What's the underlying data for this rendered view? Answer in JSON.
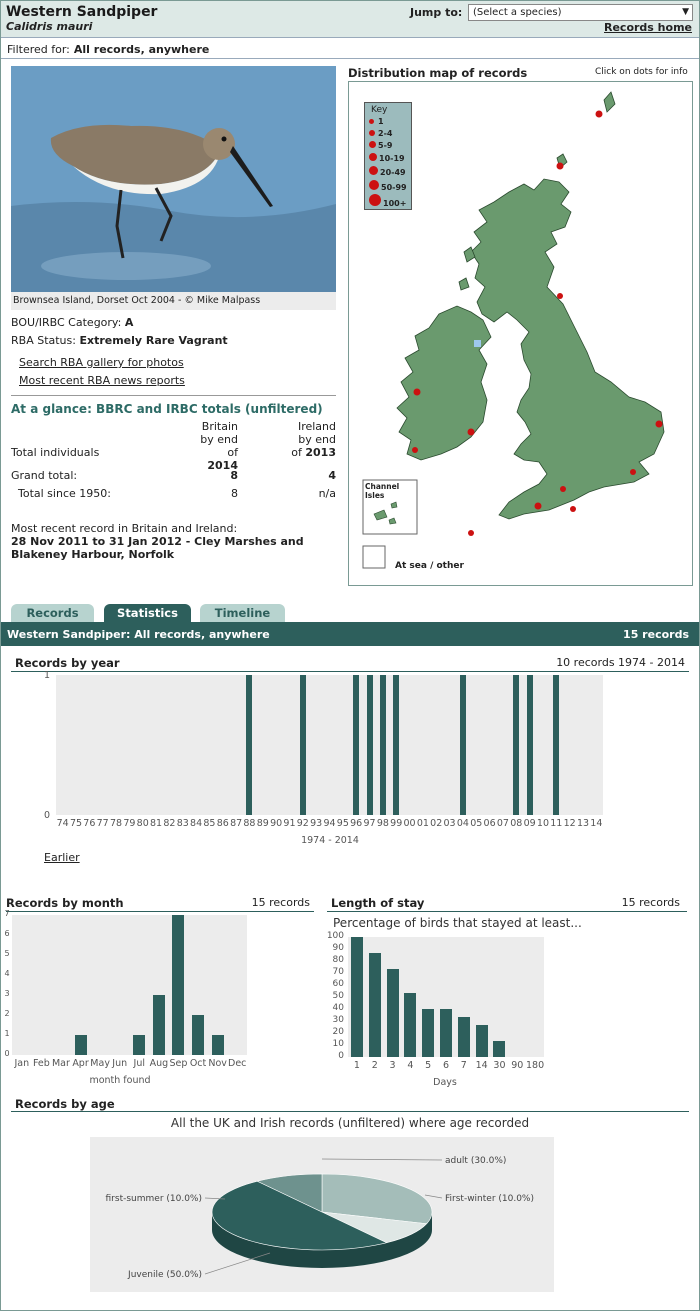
{
  "header": {
    "species": "Western Sandpiper",
    "latin": "Calidris mauri",
    "jump_label": "Jump to:",
    "jump_select": "(Select a species)",
    "records_home": "Records home"
  },
  "filter": {
    "label": "Filtered for:",
    "value": "All records, anywhere"
  },
  "photo": {
    "caption": "Brownsea Island, Dorset Oct 2004 - © Mike Malpass"
  },
  "info": {
    "category_label": "BOU/IRBC Category:",
    "category": "A",
    "status_label": "RBA Status:",
    "status": "Extremely Rare Vagrant",
    "link1": "Search RBA gallery for photos",
    "link2": "Most recent RBA news reports"
  },
  "glance": {
    "title": "At a glance: BBRC and IRBC totals (unfiltered)",
    "britain_head1": "Britain",
    "britain_head2": "by end",
    "britain_head3": "of",
    "britain_year": "2014",
    "ireland_head1": "Ireland",
    "ireland_head2": "by end",
    "ireland_head3": "of",
    "ireland_year": "2013",
    "total_individuals": "Total individuals",
    "grand_total_label": "Grand total:",
    "grand_britain": "8",
    "grand_ireland": "4",
    "since_label": "Total since 1950:",
    "since_britain": "8",
    "since_ireland": "n/a",
    "recent_label": "Most recent record in Britain and Ireland:",
    "recent_line1": "28 Nov 2011 to 31 Jan 2012 - Cley Marshes and",
    "recent_line2": "Blakeney Harbour, Norfolk"
  },
  "map": {
    "title": "Distribution map of records",
    "click": "Click on dots for info",
    "key_title": "Key",
    "key_items": [
      "1",
      "2-4",
      "5-9",
      "10-19",
      "20-49",
      "50-99",
      "100+"
    ],
    "channel": "Channel\nIsles",
    "channel1": "Channel",
    "channel2": "Isles",
    "sea": "At sea / other",
    "land_color": "#6a9a6e",
    "dot_color": "#cc1111"
  },
  "tabs": {
    "records": "Records",
    "statistics": "Statistics",
    "timeline": "Timeline"
  },
  "bar": {
    "species": "Western Sandpiper:",
    "filter": "All records, anywhere",
    "count": "15 records"
  },
  "by_year": {
    "title": "Records by year",
    "summary": "10 records 1974 - 2014",
    "axis_label": "1974 - 2014",
    "earlier": "Earlier",
    "y_top": "1",
    "y_bottom": "0"
  },
  "by_month": {
    "title": "Records by month",
    "summary": "15 records",
    "xlabel": "month found"
  },
  "stay": {
    "title": "Length of stay",
    "summary": "15 records",
    "subtitle": "Percentage of birds that stayed at least...",
    "xlabel": "Days"
  },
  "age": {
    "title": "Records by age",
    "subtitle": "All the UK and Irish records (unfiltered) where age recorded"
  },
  "chart_data": [
    {
      "type": "bar",
      "title": "Records by year",
      "xlabel": "1974 - 2014",
      "categories": [
        "74",
        "75",
        "76",
        "77",
        "78",
        "79",
        "80",
        "81",
        "82",
        "83",
        "84",
        "85",
        "86",
        "87",
        "88",
        "89",
        "90",
        "91",
        "92",
        "93",
        "94",
        "95",
        "96",
        "97",
        "98",
        "99",
        "00",
        "01",
        "02",
        "03",
        "04",
        "05",
        "06",
        "07",
        "08",
        "09",
        "10",
        "11",
        "12",
        "13",
        "14"
      ],
      "values": [
        0,
        0,
        0,
        0,
        0,
        0,
        0,
        0,
        0,
        0,
        0,
        0,
        0,
        0,
        1,
        0,
        0,
        0,
        1,
        0,
        0,
        0,
        1,
        1,
        1,
        1,
        0,
        0,
        0,
        0,
        1,
        0,
        0,
        0,
        1,
        1,
        0,
        1,
        0,
        0,
        0
      ],
      "ylim": [
        0,
        1
      ]
    },
    {
      "type": "bar",
      "title": "Records by month",
      "xlabel": "month found",
      "categories": [
        "Jan",
        "Feb",
        "Mar",
        "Apr",
        "May",
        "Jun",
        "Jul",
        "Aug",
        "Sep",
        "Oct",
        "Nov",
        "Dec"
      ],
      "values": [
        0,
        0,
        0,
        1,
        0,
        0,
        1,
        3,
        7,
        2,
        1,
        0
      ],
      "ylim": [
        0,
        7
      ]
    },
    {
      "type": "bar",
      "title": "Percentage of birds that stayed at least...",
      "xlabel": "Days",
      "categories": [
        "1",
        "2",
        "3",
        "4",
        "5",
        "6",
        "7",
        "14",
        "30",
        "90",
        "180"
      ],
      "values": [
        100,
        87,
        73,
        53,
        40,
        40,
        33,
        27,
        13,
        0,
        0
      ],
      "ylim": [
        0,
        100
      ]
    },
    {
      "type": "pie",
      "title": "All the UK and Irish records (unfiltered) where age recorded",
      "labels": [
        "adult (30.0%)",
        "First-winter (10.0%)",
        "Juvenile (50.0%)",
        "first-summer (10.0%)"
      ],
      "values": [
        30,
        10,
        50,
        10
      ]
    }
  ]
}
